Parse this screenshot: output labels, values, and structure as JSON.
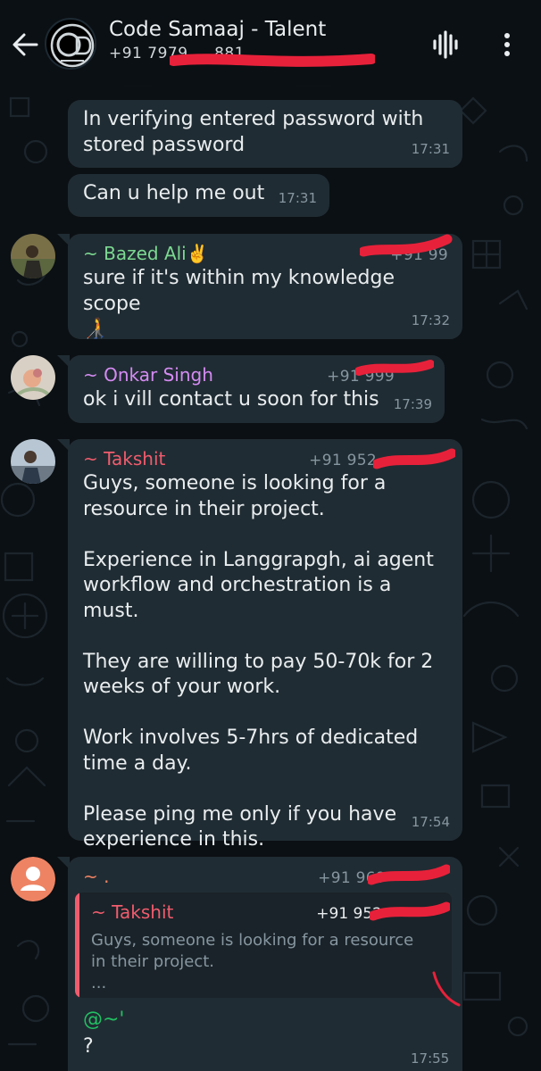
{
  "header": {
    "title": "Code Samaaj - Talent",
    "subtitle": "+91 7979 ... 881...",
    "icons": [
      "back-arrow-icon",
      "group-avatar",
      "audio-wave-icon",
      "more-vertical-icon"
    ]
  },
  "messages": [
    {
      "text": "In verifying entered password with\nstored password",
      "time": "17:31"
    },
    {
      "text": "Can u help me out",
      "time": "17:31"
    },
    {
      "sender": "~ Bazed Ali✌️",
      "phone": "+91 99",
      "text": "sure if it's within my knowledge scope\n🧑‍🦯",
      "time": "17:32"
    },
    {
      "sender": "~ Onkar Singh",
      "phone": "+91 999",
      "text": "ok i vill contact u soon for this",
      "time": "17:39"
    },
    {
      "sender": "~ Takshit",
      "phone": "+91 952",
      "text": "Guys, someone is looking for a\nresource in their project.\n\nExperience in Langgrapgh, ai agent\nworkflow and orchestration is a must.\n\nThey are willing to pay 50-70k for 2\nweeks of your work.\n\nWork involves 5-7hrs of dedicated\ntime a day.\n\nPlease ping me only if you have\nexperience in this.",
      "time": "17:54"
    },
    {
      "sender": "~ .",
      "phone": "+91 969",
      "quote": {
        "sender": "~ Takshit",
        "phone": "+91 952",
        "text": "Guys, someone is looking for a resource\nin their project.\n..."
      },
      "mention": "@~'",
      "text": "?",
      "time": "17:55"
    }
  ],
  "colors": {
    "background": "#0b1014",
    "bubble": "#202c33",
    "timestamp": "#8696a0",
    "bazed": "#53bdeb",
    "bazed_name": "#7cd992",
    "onkar": "#d48bf3",
    "takshit": "#f15c6d",
    "dot": "#ee8363",
    "mention": "#21c063",
    "redaction": "#e8213a"
  }
}
